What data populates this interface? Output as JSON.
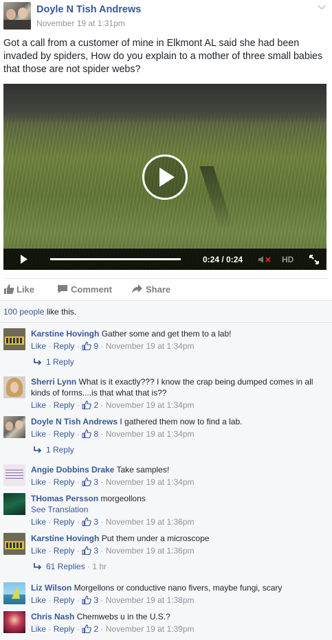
{
  "post": {
    "author": "Doyle N Tish Andrews",
    "time": "November 19 at 1:31pm",
    "text": "Got a call from a customer of mine in Elkmont AL said she had been invaded by spiders, How do you explain to a mother of three small babies that those are not spider webs?"
  },
  "video": {
    "timecode": "0:24 / 0:24",
    "hd_label": "HD",
    "progress": 1.0
  },
  "actions": {
    "like": "Like",
    "comment": "Comment",
    "share": "Share"
  },
  "likes": {
    "count_text": "100 people",
    "suffix": " like this."
  },
  "comments": [
    {
      "name": "Karstine Hovingh",
      "text": "Gather some and get them to a lab!",
      "like": "Like",
      "reply": "Reply",
      "likes": "9",
      "time": "November 19 at 1:34pm",
      "replies": "1 Reply"
    },
    {
      "name": "Sherri Lynn",
      "text": "What is it exactly??? I know the crap being dumped comes in all kinds of forms....is that what that is??",
      "like": "Like",
      "reply": "Reply",
      "likes": "2",
      "time": "November 19 at 1:34pm"
    },
    {
      "name": "Doyle N Tish Andrews",
      "text": "I gathered them now to find a lab.",
      "like": "Like",
      "reply": "Reply",
      "likes": "8",
      "time": "November 19 at 1:34pm",
      "replies": "1 Reply"
    },
    {
      "name": "Angie Dobbins Drake",
      "text": "Take samples!",
      "like": "Like",
      "reply": "Reply",
      "likes": "3",
      "time": "November 19 at 1:34pm"
    },
    {
      "name": "THomas Persson",
      "text": "morgeollons",
      "see_translation": "See Translation",
      "like": "Like",
      "reply": "Reply",
      "likes": "3",
      "time": "November 19 at 1:36pm"
    },
    {
      "name": "Karstine Hovingh",
      "text": "Put them under a microscope",
      "like": "Like",
      "reply": "Reply",
      "likes": "3",
      "time": "November 19 at 1:36pm",
      "replies": "61 Replies",
      "replies_time": "1 hr"
    },
    {
      "name": "Liz Wilson",
      "text": "Morgellons or conductive nano fivers, maybe fungi, scary",
      "like": "Like",
      "reply": "Reply",
      "likes": "3",
      "time": "November 19 at 1:38pm"
    },
    {
      "name": "Chris Nash",
      "text": "Chemwebs u in the U.S.?",
      "like": "Like",
      "reply": "Reply",
      "likes": "2",
      "time": "November 19 at 1:39pm"
    }
  ],
  "colors": {
    "link": "#365899",
    "meta": "#90949c",
    "comments_bg": "#f6f7f9"
  }
}
